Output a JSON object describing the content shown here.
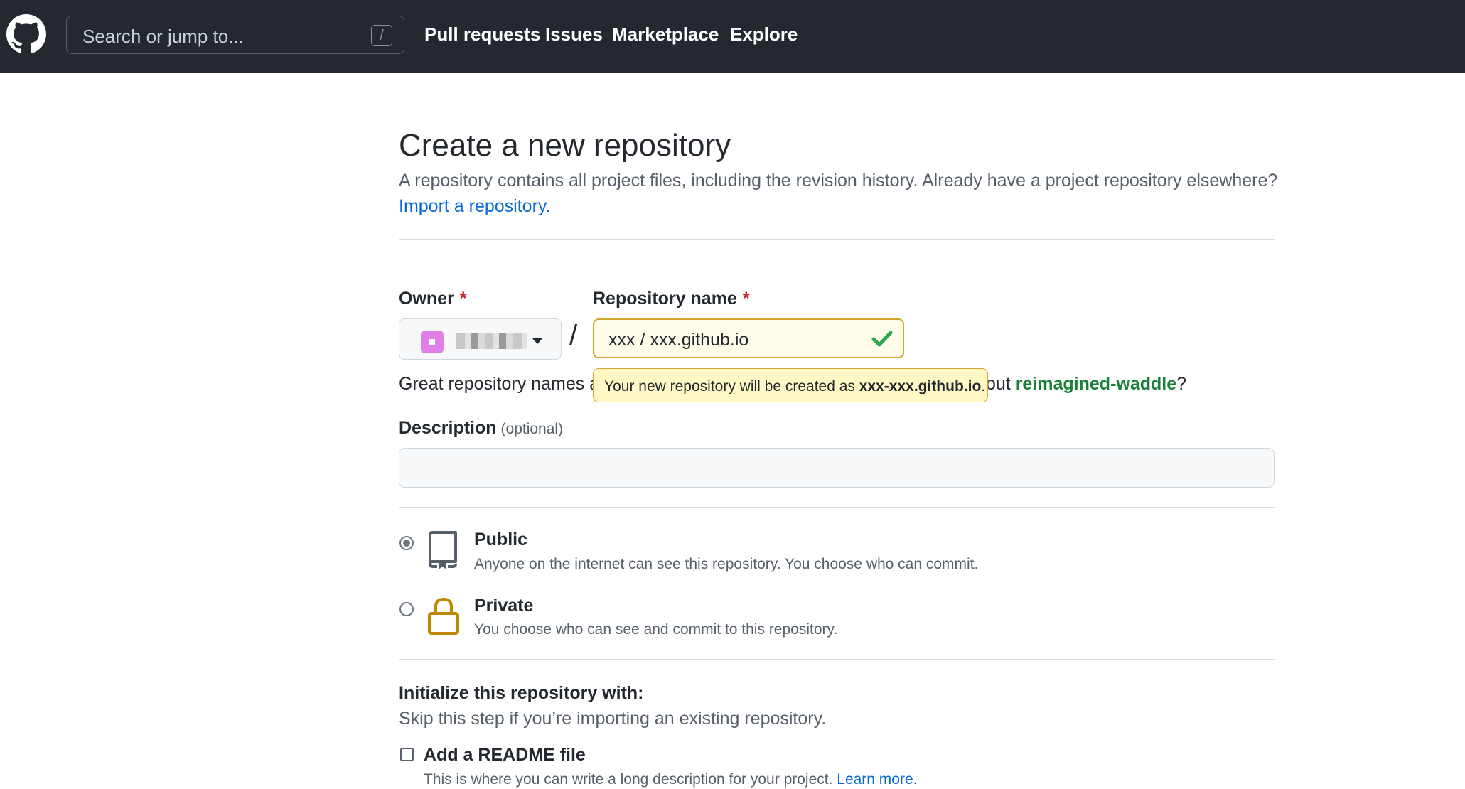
{
  "header": {
    "search_placeholder": "Search or jump to...",
    "search_shortcut": "/",
    "nav": [
      "Pull requests",
      "Issues",
      "Marketplace",
      "Explore"
    ]
  },
  "page": {
    "title": "Create a new repository",
    "subtitle": "A repository contains all project files, including the revision history. Already have a project repository elsewhere?",
    "import_link": "Import a repository."
  },
  "form": {
    "owner_label": "Owner",
    "required_mark": "*",
    "separator": "/",
    "repo_name_label": "Repository name",
    "repo_name_value": "xxx / xxx.github.io",
    "hint_start": "Great repository names a",
    "hint_end_prefix": "out ",
    "hint_suggestion": "reimagined-waddle",
    "hint_end_suffix": "?",
    "tooltip_text": "Your new repository will be created as ",
    "tooltip_name": "xxx-xxx.github.io",
    "tooltip_end": ".",
    "description_label": "Description",
    "description_optional": "(optional)",
    "description_value": ""
  },
  "visibility": {
    "selected": "Public",
    "public_title": "Public",
    "public_desc": "Anyone on the internet can see this repository. You choose who can commit.",
    "private_title": "Private",
    "private_desc": "You choose who can see and commit to this repository."
  },
  "init": {
    "title": "Initialize this repository with:",
    "subtitle": "Skip this step if you’re importing an existing repository.",
    "readme_label": "Add a README file",
    "readme_checked": false,
    "readme_desc": "This is where you can write a long description for your project. ",
    "learn_more": "Learn more."
  },
  "colors": {
    "header_bg": "#24292f",
    "link": "#0969da",
    "success": "#1a7f37",
    "required": "#cf222e",
    "tooltip_bg": "#fff8c5",
    "private_icon": "#bf8700"
  }
}
